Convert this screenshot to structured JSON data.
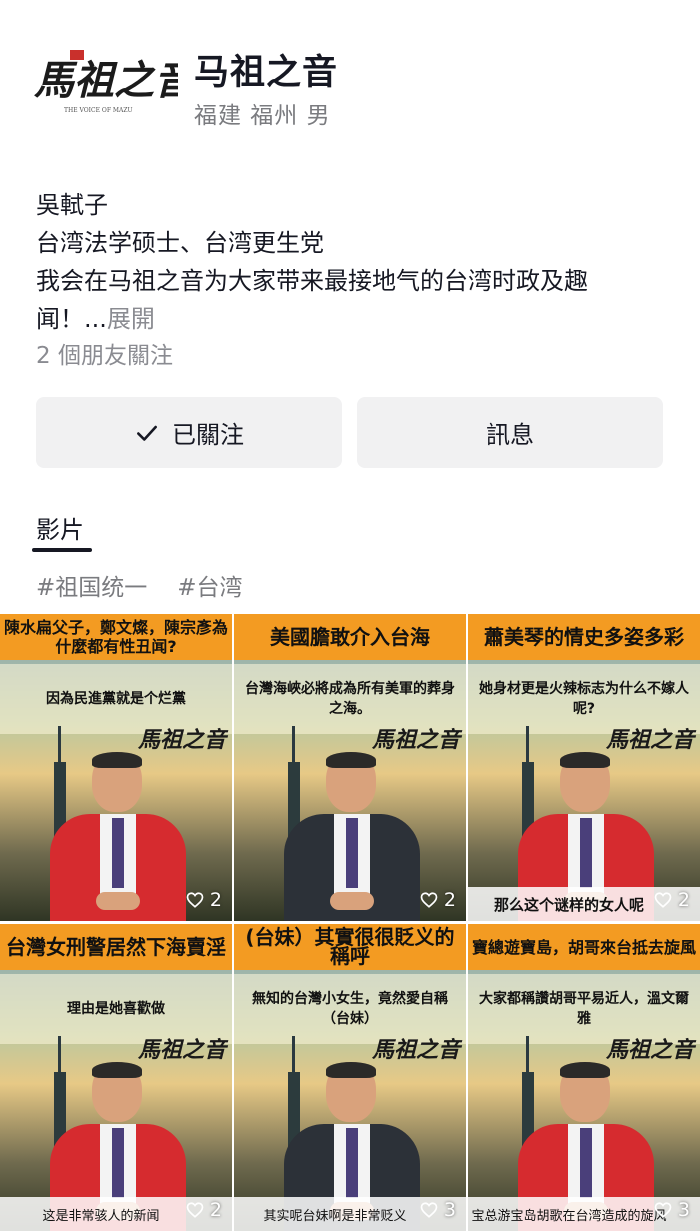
{
  "profile": {
    "name": "马祖之音",
    "meta": "福建 福州 男",
    "avatar_logo_text": "馬祖之音",
    "avatar_logo_subtitle": "THE VOICE OF MAZU"
  },
  "bio": {
    "line1": "吳軾子",
    "line2": "台湾法学硕士、台湾更生党",
    "line3": "我会在马祖之音为大家带来最接地气的台湾时政及趣",
    "line4": "闻！...",
    "more": "展開"
  },
  "friends": "2 個朋友關注",
  "buttons": {
    "follow": "已關注",
    "message": "訊息"
  },
  "tabs": {
    "video": "影片"
  },
  "tags": [
    "#祖国统一",
    "#台湾"
  ],
  "videos": [
    {
      "caption": "陳水扁父子，鄭文燦，陳宗彥為什麼都有性丑闻?",
      "sub": "因為民進黨就是个烂黨",
      "logo": "馬祖之音",
      "bottom": "",
      "likes": "2",
      "outfit": "red"
    },
    {
      "caption": "美國膽敢介入台海",
      "sub": "台灣海峽必將成為所有美軍的葬身之海。",
      "logo": "馬祖之音",
      "bottom": "",
      "likes": "2",
      "outfit": "dark"
    },
    {
      "caption": "蕭美琴的情史多姿多彩",
      "sub": "她身材更是火辣标志为什么不嫁人呢?",
      "logo": "馬祖之音",
      "bottom": "那么这个谜样的女人呢",
      "likes": "2",
      "outfit": "red"
    },
    {
      "caption": "台灣女刑警居然下海賣淫",
      "sub": "理由是她喜歡做",
      "logo": "馬祖之音",
      "bottom": "这是非常骇人的新闻",
      "likes": "2",
      "outfit": "red"
    },
    {
      "caption": "(台妹）其實很很貶义的稱呼",
      "sub": "無知的台灣小女生，竟然愛自稱（台妹）",
      "logo": "馬祖之音",
      "bottom": "其实呢台妹啊是非常贬义",
      "likes": "3",
      "outfit": "dark"
    },
    {
      "caption": "寶總遊寶島，胡哥來台抵去旋風",
      "sub": "大家都稱讚胡哥平易近人，溫文爾雅",
      "logo": "馬祖之音",
      "bottom": "宝总游宝岛胡歌在台湾造成的旋风",
      "likes": "3",
      "outfit": "red"
    }
  ],
  "colors": {
    "caption_orange": "#f39b22",
    "button_bg": "#f1f1f2",
    "muted_text": "#8a8b91"
  }
}
